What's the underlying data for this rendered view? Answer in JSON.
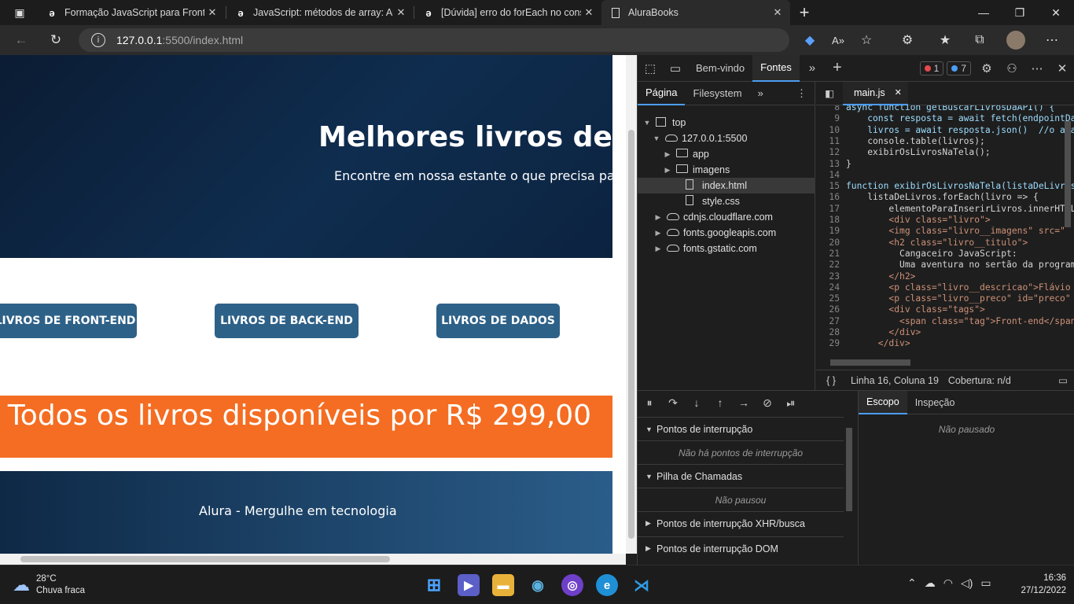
{
  "tabs": [
    {
      "title": "Formação JavaScript para Front-end",
      "favicon": "a"
    },
    {
      "title": "JavaScript: métodos de array: Aula",
      "favicon": "a"
    },
    {
      "title": "[Dúvida] erro do forEach no console",
      "favicon": "a"
    },
    {
      "title": "AluraBooks",
      "favicon": "page"
    }
  ],
  "address": {
    "host": "127.0.0.1",
    "path": ":5500/index.html"
  },
  "page": {
    "hero_title": "Melhores livros de Programação",
    "hero_subtitle": "Encontre em nossa estante o que precisa para seu desenvolvimento!",
    "categories": [
      "LIVROS DE FRONT-END",
      "LIVROS DE BACK-END",
      "LIVROS DE DADOS"
    ],
    "promo": "Todos os livros disponíveis por R$ 299,00",
    "footer": "Alura - Mergulhe em tecnologia"
  },
  "devtools": {
    "tabs": [
      "Bem-vindo",
      "Fontes"
    ],
    "errors": "1",
    "messages": "7",
    "nav_tabs": [
      "Página",
      "Filesystem"
    ],
    "tree": [
      {
        "label": "top",
        "type": "frame",
        "level": 0
      },
      {
        "label": "127.0.0.1:5500",
        "type": "cloud",
        "level": 1
      },
      {
        "label": "app",
        "type": "folder",
        "level": 2
      },
      {
        "label": "imagens",
        "type": "folder",
        "level": 2
      },
      {
        "label": "index.html",
        "type": "file",
        "level": 2
      },
      {
        "label": "style.css",
        "type": "file",
        "level": 2
      },
      {
        "label": "cdnjs.cloudflare.com",
        "type": "cloud",
        "level": 1
      },
      {
        "label": "fonts.googleapis.com",
        "type": "cloud",
        "level": 1
      },
      {
        "label": "fonts.gstatic.com",
        "type": "cloud",
        "level": 1
      }
    ],
    "editor_tab": "main.js",
    "code_lines": [
      {
        "n": "8",
        "t": "async function getBuscarLivrosDaAPI() {"
      },
      {
        "n": "9",
        "t": "    const resposta = await fetch(endpointDaAPI)"
      },
      {
        "n": "10",
        "t": "    livros = await resposta.json()  //o await"
      },
      {
        "n": "11",
        "t": "    console.table(livros);"
      },
      {
        "n": "12",
        "t": "    exibirOsLivrosNaTela();"
      },
      {
        "n": "13",
        "t": "}"
      },
      {
        "n": "14",
        "t": ""
      },
      {
        "n": "15",
        "t": "function exibirOsLivrosNaTela(listaDeLivros) {"
      },
      {
        "n": "16",
        "t": "    listaDeLivros.forEach(livro => {"
      },
      {
        "n": "17",
        "t": "        elementoParaInserirLivros.innerHTML"
      },
      {
        "n": "18",
        "t": "        <div class=\"livro\">"
      },
      {
        "n": "19",
        "t": "        <img class=\"livro__imagens\" src=\""
      },
      {
        "n": "20",
        "t": "        <h2 class=\"livro__titulo\">"
      },
      {
        "n": "21",
        "t": "          Cangaceiro JavaScript:"
      },
      {
        "n": "22",
        "t": "          Uma aventura no sertão da programação"
      },
      {
        "n": "23",
        "t": "        </h2>"
      },
      {
        "n": "24",
        "t": "        <p class=\"livro__descricao\">Flávio"
      },
      {
        "n": "25",
        "t": "        <p class=\"livro__preco\" id=\"preco\""
      },
      {
        "n": "26",
        "t": "        <div class=\"tags\">"
      },
      {
        "n": "27",
        "t": "          <span class=\"tag\">Front-end</span>"
      },
      {
        "n": "28",
        "t": "        </div>"
      },
      {
        "n": "29",
        "t": "      </div>"
      }
    ],
    "status_position": "Linha 16, Coluna 19",
    "status_coverage": "Cobertura: n/d",
    "sections": [
      {
        "title": "Pontos de interrupção",
        "empty": "Não há pontos de interrupção",
        "open": true
      },
      {
        "title": "Pilha de Chamadas",
        "empty": "Não pausou",
        "open": true
      },
      {
        "title": "Pontos de interrupção XHR/busca",
        "open": false
      },
      {
        "title": "Pontos de interrupção DOM",
        "open": false
      }
    ],
    "scope_tabs": [
      "Escopo",
      "Inspeção"
    ],
    "scope_status": "Não pausado"
  },
  "taskbar": {
    "weather_temp": "28°C",
    "weather_desc": "Chuva fraca",
    "time": "16:36",
    "date": "27/12/2022"
  },
  "colors": {
    "accent": "#4c9df3",
    "promo": "#f46d22",
    "category_button": "#2e6188",
    "hero": "#0f2d4f"
  }
}
